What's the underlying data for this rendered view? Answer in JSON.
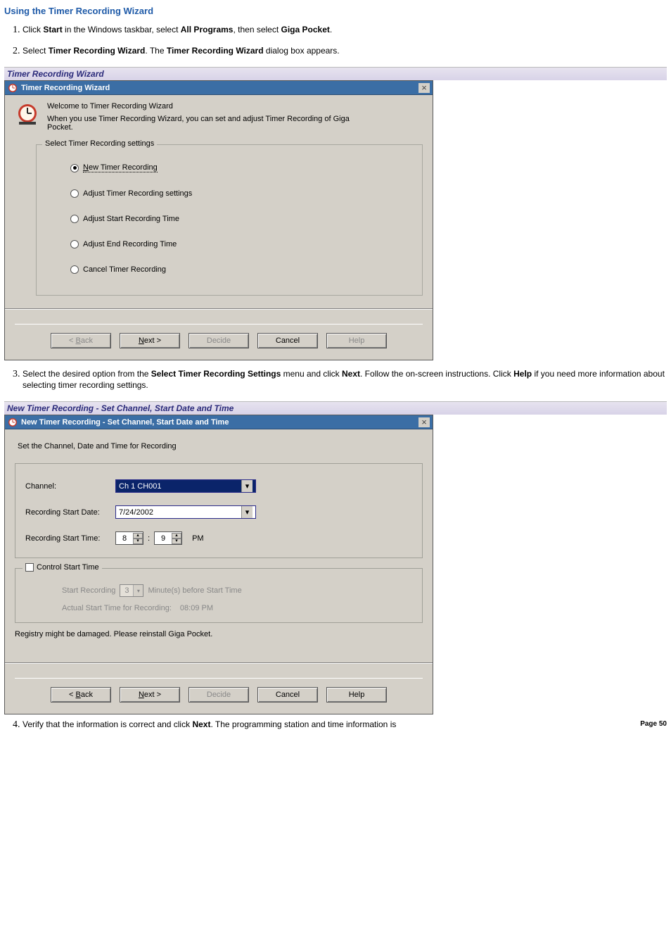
{
  "heading": "Using the Timer Recording Wizard",
  "steps": {
    "s1_a": "Click ",
    "s1_b": "Start",
    "s1_c": " in the Windows taskbar, select ",
    "s1_d": "All Programs",
    "s1_e": ", then select ",
    "s1_f": "Giga Pocket",
    "s1_g": ".",
    "s2_a": "Select ",
    "s2_b": "Timer Recording Wizard",
    "s2_c": ". The ",
    "s2_d": "Timer Recording Wizard",
    "s2_e": " dialog box appears.",
    "s3_a": "Select the desired option from the ",
    "s3_b": "Select Timer Recording Settings",
    "s3_c": " menu and click ",
    "s3_d": "Next",
    "s3_e": ". Follow the on-screen instructions. Click ",
    "s3_f": "Help",
    "s3_g": " if you need more information about selecting timer recording settings.",
    "s4_a": "Verify that the information is correct and click ",
    "s4_b": "Next",
    "s4_c": ". The programming station and time information is"
  },
  "caption1": "Timer Recording Wizard",
  "caption2": "New Timer Recording - Set Channel, Start Date and Time",
  "dialog1": {
    "title": "Timer Recording Wizard",
    "close": "×",
    "welcome_line1": "Welcome to Timer Recording Wizard",
    "welcome_line2": "When you use Timer Recording Wizard, you can set and adjust Timer Recording of Giga Pocket.",
    "legend": "Select Timer Recording settings",
    "radios": {
      "r1_u": "N",
      "r1_rest": "ew Timer Recording",
      "r2": "Adjust Timer Recording settings",
      "r3": "Adjust Start Recording Time",
      "r4": "Adjust End Recording Time",
      "r5": "Cancel Timer Recording"
    },
    "buttons": {
      "back_u": "B",
      "back_lt": "< ",
      "back_rest": "ack",
      "next_u": "N",
      "next_rest": "ext >",
      "decide": "Decide",
      "cancel": "Cancel",
      "help": "Help"
    }
  },
  "dialog2": {
    "title": "New Timer Recording - Set Channel, Start Date and Time",
    "close": "×",
    "intro": "Set the Channel, Date and Time for Recording",
    "labels": {
      "channel": "Channel:",
      "date": "Recording Start Date:",
      "time": "Recording Start Time:"
    },
    "channel_value": "Ch 1 CH001",
    "date_value": "7/24/2002",
    "hour": "8",
    "minute": "9",
    "ampm": "PM",
    "control_legend": "Control Start Time",
    "control": {
      "start_label": "Start Recording",
      "spin_value": "3",
      "tail": "Minute(s) before Start Time",
      "actual_label": "Actual Start Time for Recording:",
      "actual_val": "08:09 PM"
    },
    "status": "Registry might be damaged. Please reinstall Giga Pocket.",
    "buttons": {
      "back_u": "B",
      "back_lt": "< ",
      "back_rest": "ack",
      "next_u": "N",
      "next_rest": "ext >",
      "decide": "Decide",
      "cancel": "Cancel",
      "help": "Help"
    }
  },
  "footer": "Page 50"
}
